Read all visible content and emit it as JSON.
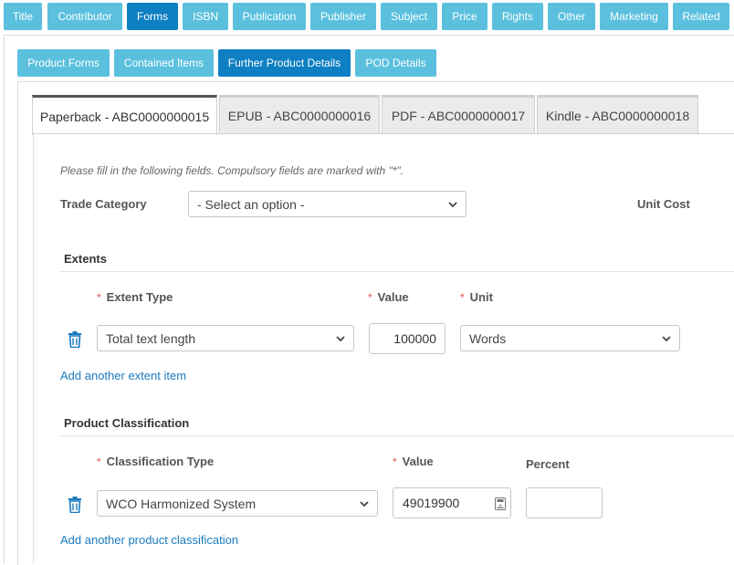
{
  "top_nav": [
    "Title",
    "Contributor",
    "Forms",
    "ISBN",
    "Publication",
    "Publisher",
    "Subject",
    "Price",
    "Rights",
    "Other",
    "Marketing",
    "Related"
  ],
  "sub_nav": [
    "Product Forms",
    "Contained Items",
    "Further Product Details",
    "POD Details"
  ],
  "tabs": [
    "Paperback - ABC0000000015",
    "EPUB - ABC0000000016",
    "PDF - ABC0000000017",
    "Kindle - ABC0000000018"
  ],
  "form": {
    "hint": "Please fill in the following fields. Compulsory fields are marked with \"*\".",
    "trade_category_label": "Trade Category",
    "trade_category_value": "- Select an option -",
    "unit_cost_label": "Unit Cost",
    "required_mark": "*"
  },
  "extents": {
    "heading": "Extents",
    "extent_type_label": "Extent Type",
    "value_label": "Value",
    "unit_label": "Unit",
    "extent_type_value": "Total text length",
    "value": "100000",
    "unit_value": "Words",
    "add_link": "Add another extent item"
  },
  "classification": {
    "heading": "Product Classification",
    "type_label": "Classification Type",
    "value_label": "Value",
    "percent_label": "Percent",
    "type_value": "WCO Harmonized System",
    "value": "49019900",
    "percent": "",
    "add_link": "Add another product classification"
  },
  "colors": {
    "nav_button": "#5bc0de",
    "nav_active": "#0e7fc2",
    "link": "#1a7bbf",
    "required": "#d9534f"
  }
}
